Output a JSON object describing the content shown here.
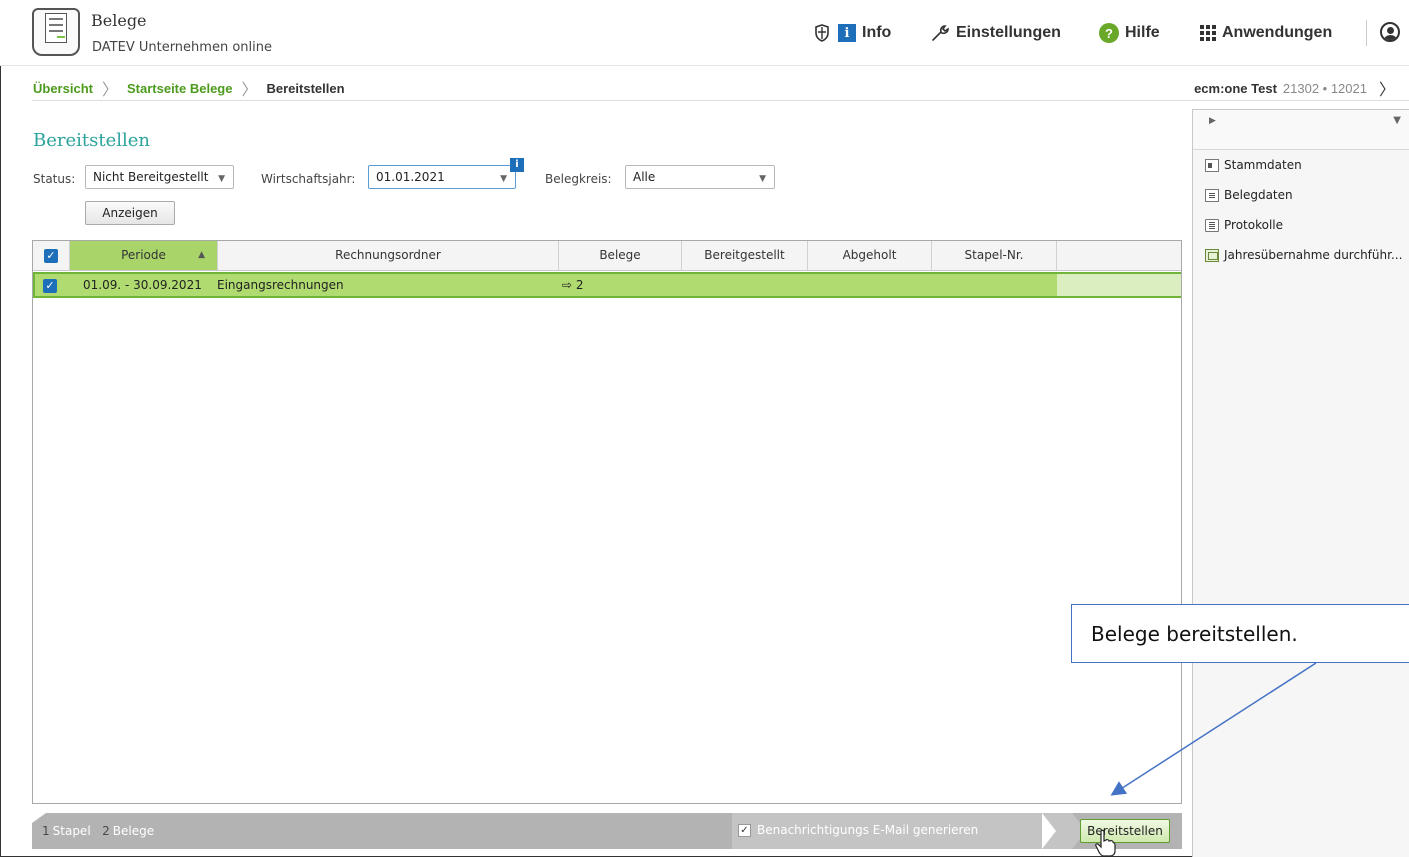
{
  "header": {
    "app_title": "Belege",
    "app_subtitle": "DATEV Unternehmen online",
    "nav": {
      "info_icon": "i",
      "info": "Info",
      "settings": "Einstellungen",
      "help_icon": "?",
      "help": "Hilfe",
      "apps": "Anwendungen"
    }
  },
  "breadcrumb": {
    "items": [
      "Übersicht",
      "Startseite Belege",
      "Bereitstellen"
    ],
    "sep": "〉"
  },
  "context": {
    "name": "ecm:one Test",
    "numbers": "21302 • 12021",
    "chev": "〉"
  },
  "page": {
    "title": "Bereitstellen"
  },
  "filters": {
    "status_label": "Status:",
    "status_value": "Nicht Bereitgestellt",
    "year_label": "Wirtschaftsjahr:",
    "year_value": "01.01.2021",
    "info_badge": "i",
    "circle_label": "Belegkreis:",
    "circle_value": "Alle",
    "dropdown_arrow": "▼",
    "show_button": "Anzeigen"
  },
  "grid": {
    "columns": [
      "Periode",
      "Rechnungsordner",
      "Belege",
      "Bereitgestellt",
      "Abgeholt",
      "Stapel-Nr."
    ],
    "sort_arrow": "▲",
    "check": "✓",
    "rows": [
      {
        "periode": "01.09. - 30.09.2021",
        "rechnungsordner": "Eingangsrechnungen",
        "belege": "⇨ 2",
        "bereitgestellt": "",
        "abgeholt": "",
        "stapel_nr": ""
      }
    ]
  },
  "statusbar": {
    "stapel_count": "1",
    "stapel_label": "Stapel",
    "belege_count": "2",
    "belege_label": "Belege",
    "email_check": "✓",
    "email_label": "Benachrichtigungs E-Mail generieren",
    "submit_button": "Bereitstellen"
  },
  "right_panel": {
    "toggle": "▶",
    "pin": "▼",
    "items": [
      "Stammdaten",
      "Belegdaten",
      "Protokolle",
      "Jahresübernahme durchführ..."
    ]
  },
  "callout": {
    "text": "Belege bereitstellen."
  },
  "colors": {
    "accent_green": "#4d9b1e",
    "row_highlight": "#b0db70",
    "title_teal": "#2aa39c",
    "checkbox_blue": "#1e6fb9",
    "callout_border": "#4472c4"
  }
}
